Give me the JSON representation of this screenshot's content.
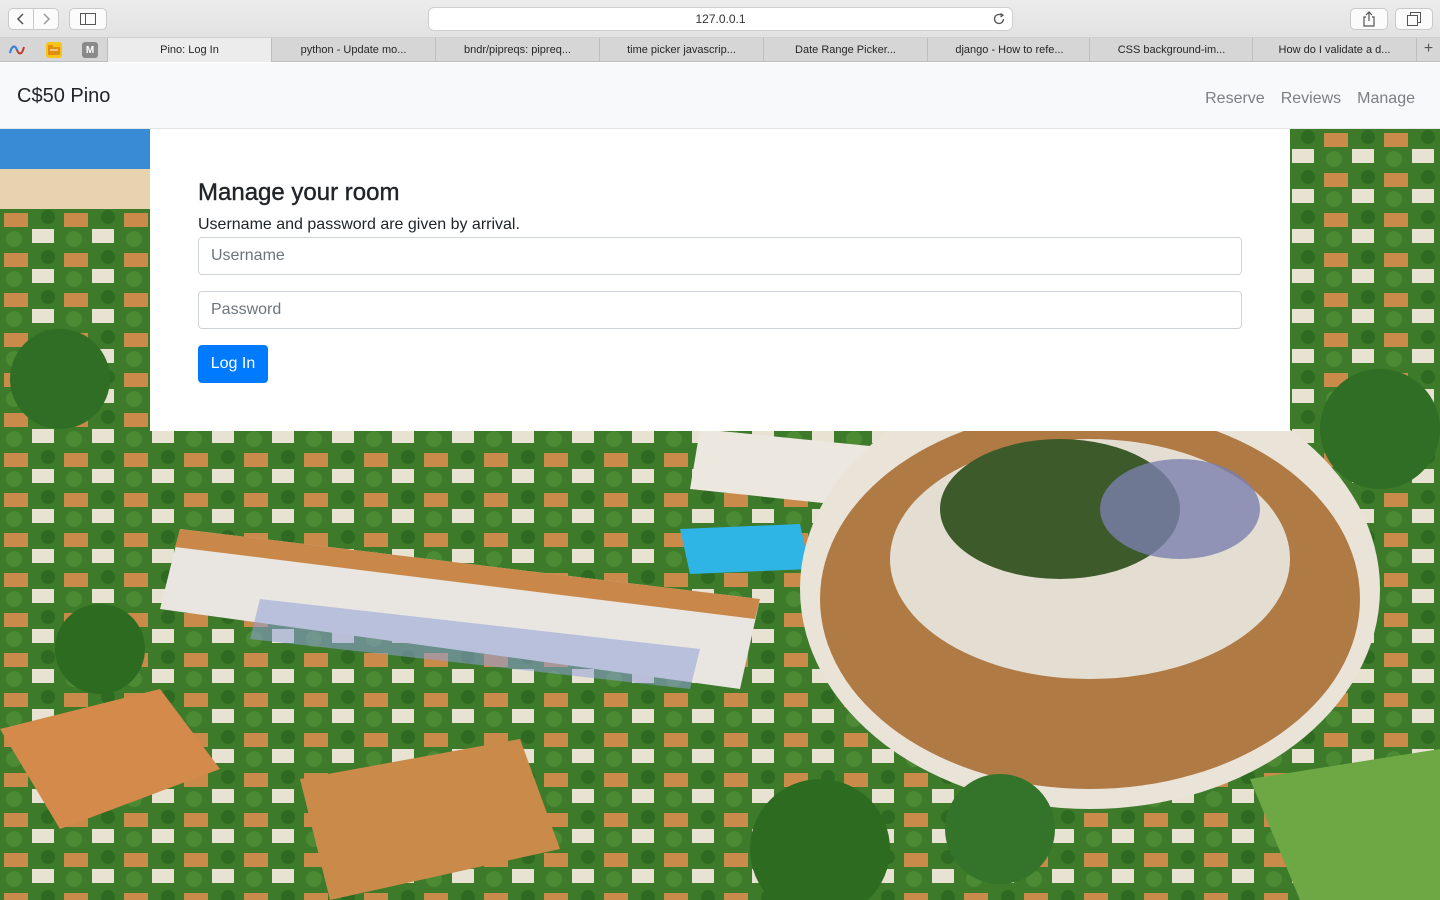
{
  "browser": {
    "url": "127.0.0.1",
    "tabs": [
      {
        "label": "Pino: Log In",
        "active": true
      },
      {
        "label": "python - Update mo..."
      },
      {
        "label": "bndr/pipreqs: pipreq..."
      },
      {
        "label": "time picker javascrip..."
      },
      {
        "label": "Date Range Picker..."
      },
      {
        "label": "django - How to refe..."
      },
      {
        "label": "CSS background-im..."
      },
      {
        "label": "How do I validate a d..."
      }
    ],
    "favicon_m": "M",
    "new_tab_label": "+"
  },
  "navbar": {
    "brand": "C$50 Pino",
    "links": [
      "Reserve",
      "Reviews",
      "Manage"
    ]
  },
  "login": {
    "title": "Manage your room",
    "subtitle": "Username and password are given by arrival.",
    "username_placeholder": "Username",
    "password_placeholder": "Password",
    "submit_label": "Log In"
  },
  "colors": {
    "primary": "#007bff",
    "navbar_bg": "#f8f9fa"
  }
}
